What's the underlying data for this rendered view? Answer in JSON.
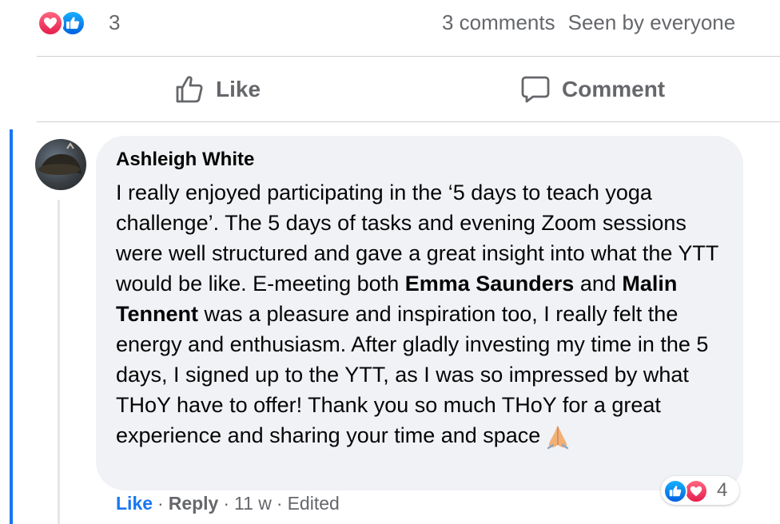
{
  "summary": {
    "reaction_icons": [
      "love-reaction",
      "like-reaction"
    ],
    "reaction_count": "3",
    "comments": "3 comments",
    "seen_by": "Seen by everyone"
  },
  "actions": {
    "like": "Like",
    "comment": "Comment"
  },
  "comment": {
    "author": "Ashleigh White",
    "text_1": "I really enjoyed participating in the ‘5 days to teach yoga challenge’. The 5 days of tasks and evening Zoom sessions were well structured and gave a great insight into what the YTT would be like. E-meeting both ",
    "mention_1": "Emma Saunders",
    "text_2": " and ",
    "mention_2": "Malin Tennent",
    "text_3": " was a pleasure and inspiration too, I really felt the energy and enthusiasm. After gladly investing my time in the 5 days, I signed up to the YTT, as I was so impressed by what THoY have to offer! Thank you so much THoY for a great experience and sharing your time and space",
    "emoji": "folded-hands",
    "reaction_count": "4",
    "like_label": "Like",
    "reply_label": "Reply",
    "time": "11 w",
    "edited": "Edited",
    "separator": "·"
  },
  "colors": {
    "brand_blue": "#1877f2",
    "love_red": "#e61e4d",
    "secondary_text": "#65676b",
    "bubble_bg": "#f0f2f5"
  }
}
